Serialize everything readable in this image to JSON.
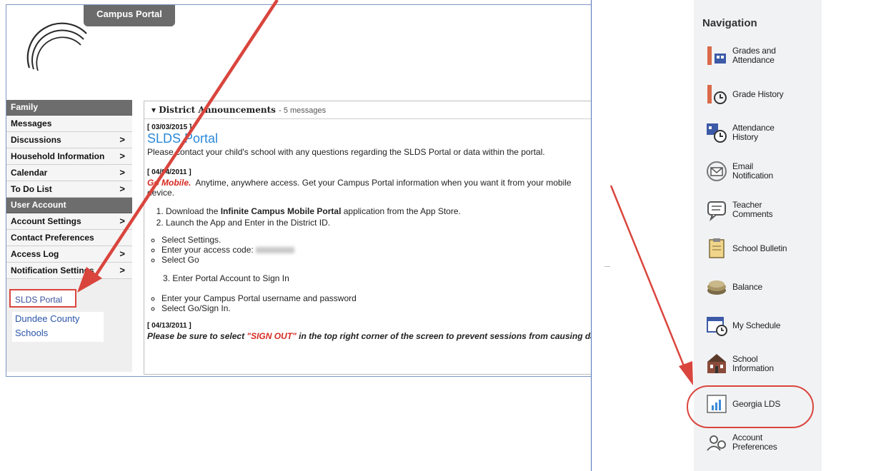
{
  "left_panel": {
    "app_tab": "Campus Portal",
    "sidebar": {
      "family_header": "Family",
      "family_items": [
        {
          "label": "Messages",
          "chevron": false
        },
        {
          "label": "Discussions",
          "chevron": true
        },
        {
          "label": "Household Information",
          "chevron": true
        },
        {
          "label": "Calendar",
          "chevron": true
        },
        {
          "label": "To Do List",
          "chevron": true
        }
      ],
      "account_header": "User Account",
      "account_items": [
        {
          "label": "Account Settings",
          "chevron": true
        },
        {
          "label": "Contact Preferences",
          "chevron": false
        },
        {
          "label": "Access Log",
          "chevron": true
        },
        {
          "label": "Notification Settings",
          "chevron": true
        }
      ],
      "chevron_glyph": ">",
      "slds_link": "SLDS Portal",
      "district_link": "Dundee County Schools"
    },
    "announcements": {
      "header": "District Announcements",
      "count": "- 5 messages",
      "items": {
        "a1_date": "[ 03/03/2015 ]",
        "a1_title": "SLDS Portal",
        "a1_text": "Please contact your child's school with any questions regarding the SLDS Portal or data within the portal.",
        "a2_date": "[ 04/04/2011 ]",
        "a2_mobile": "Go Mobile.",
        "a2_text": "Anytime, anywhere access.  Get your Campus Portal information when you want it from your mobile device.",
        "step1_prefix": "Download the ",
        "step1_bold": "Infinite Campus Mobile Portal",
        "step1_suffix": " application from the App Store.",
        "step2": "Launch the App and Enter in the District ID.",
        "sub1": "Select Settings.",
        "sub2_prefix": "Enter your access code:",
        "sub3": "Select Go",
        "step3": "3. Enter Portal Account to Sign In",
        "sub4": "Enter your Campus Portal username and password",
        "sub5": "Select Go/Sign In.",
        "a3_date": "[ 04/13/2011 ]",
        "a3_prefix": "Please be sure to select ",
        "a3_red": "\"SIGN OUT\"",
        "a3_suffix": " in the top right corner of the screen to prevent sessions from causing database"
      }
    }
  },
  "right_panel": {
    "nav_title": "Navigation",
    "items": [
      {
        "label": "Grades and Attendance",
        "icon": "grades-icon"
      },
      {
        "label": "Grade History",
        "icon": "grade-history-icon"
      },
      {
        "label": "Attendance History",
        "icon": "attendance-history-icon"
      },
      {
        "label": "Email Notification",
        "icon": "email-icon"
      },
      {
        "label": "Teacher Comments",
        "icon": "comments-icon"
      },
      {
        "label": "School Bulletin",
        "icon": "bulletin-icon"
      },
      {
        "label": "Balance",
        "icon": "balance-icon"
      },
      {
        "label": "My Schedule",
        "icon": "schedule-icon"
      },
      {
        "label": "School Information",
        "icon": "school-icon"
      },
      {
        "label": "Georgia LDS",
        "icon": "chart-icon"
      },
      {
        "label": "Account Preferences",
        "icon": "account-icon"
      }
    ]
  },
  "colors": {
    "arrow_red": "#d9453d",
    "link_blue": "#2b88d9",
    "sidebar_header_gray": "#6d6d6d",
    "panel_border_blue": "#5273b8"
  }
}
